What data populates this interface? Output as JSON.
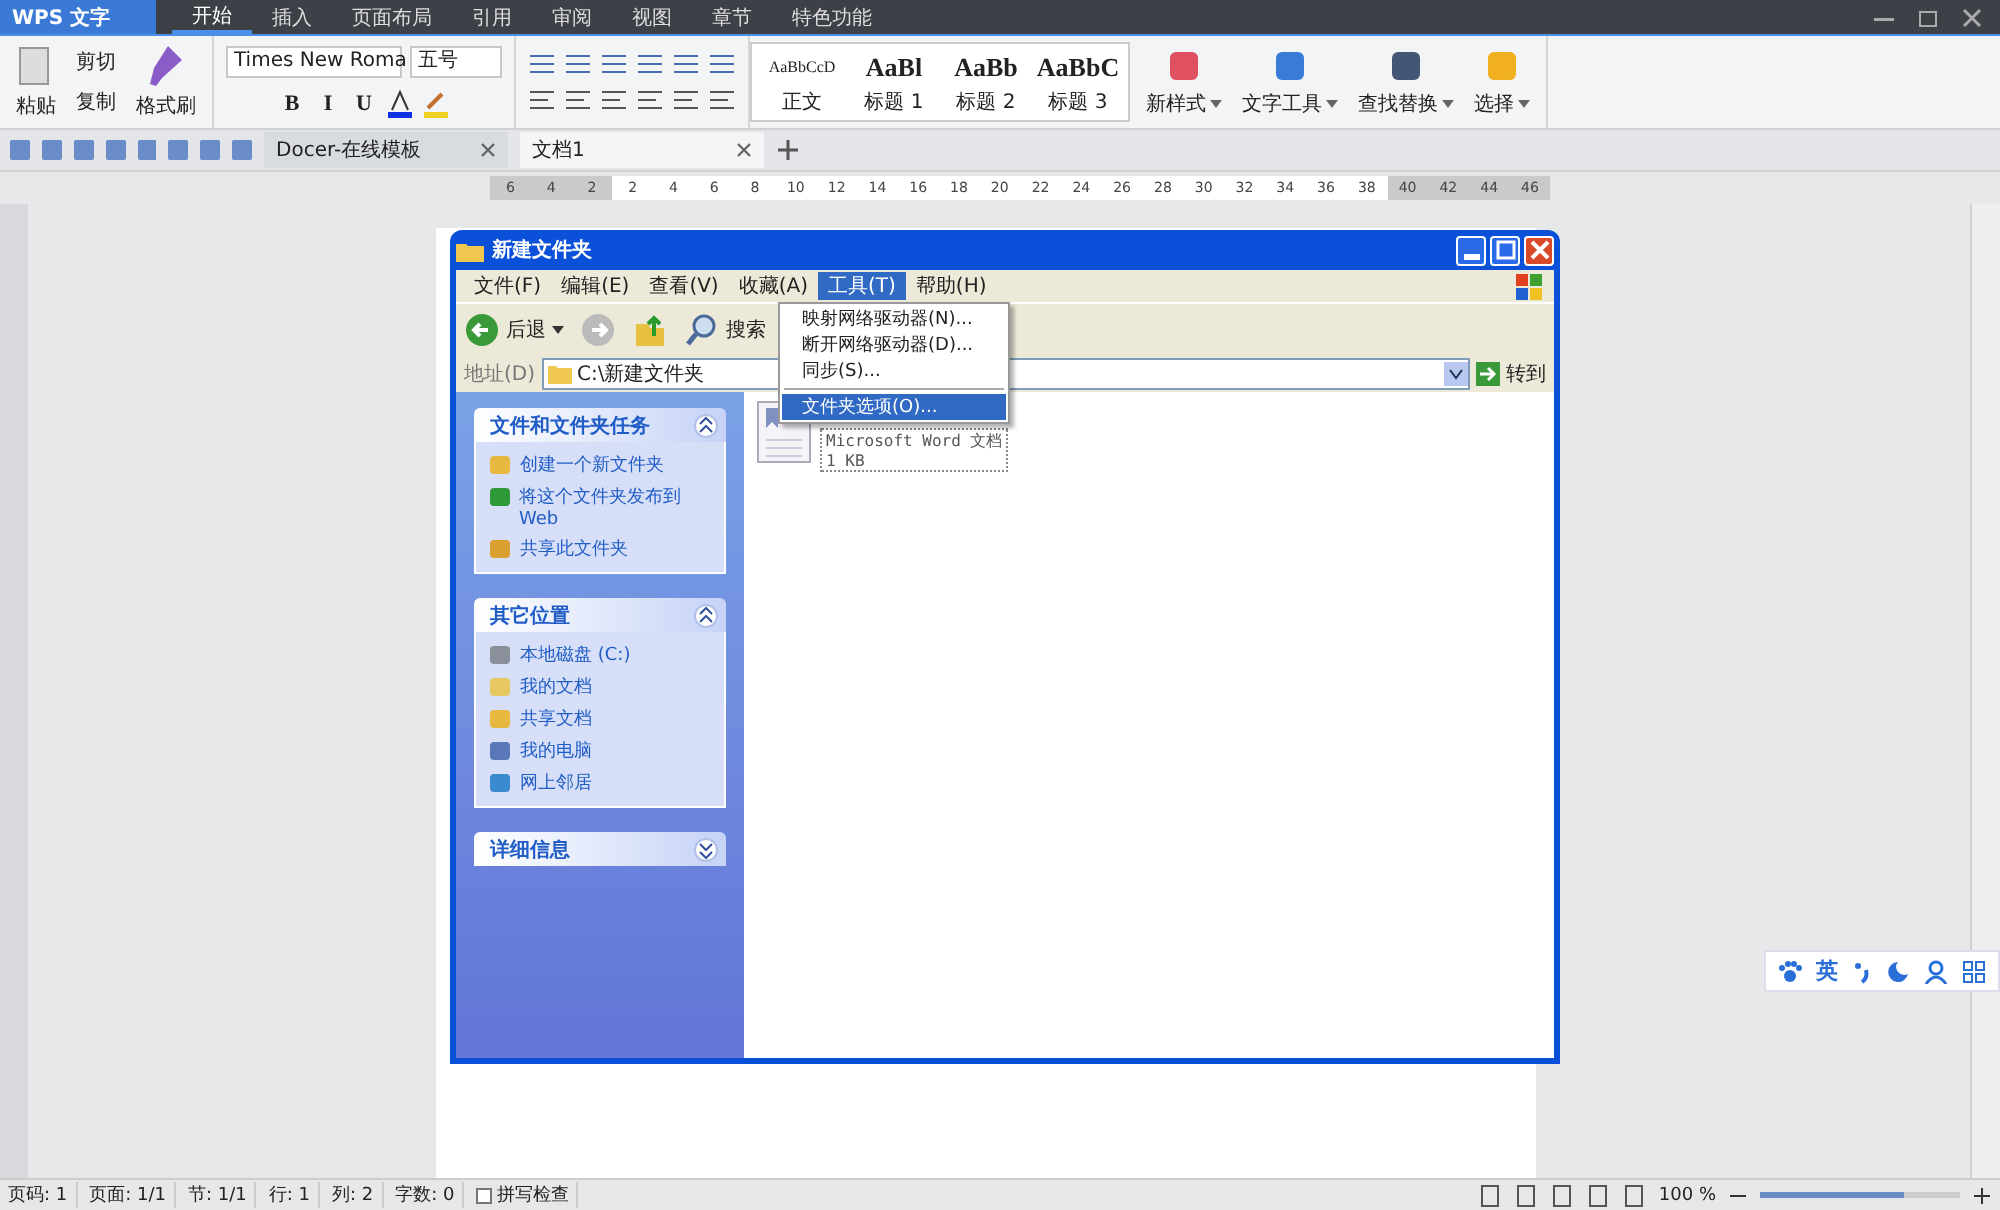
{
  "app": {
    "logo": "WPS 文字"
  },
  "ribbon_tabs": [
    {
      "label": "开始",
      "selected": true
    },
    {
      "label": "插入",
      "selected": false
    },
    {
      "label": "页面布局",
      "selected": false
    },
    {
      "label": "引用",
      "selected": false
    },
    {
      "label": "审阅",
      "selected": false
    },
    {
      "label": "视图",
      "selected": false
    },
    {
      "label": "章节",
      "selected": false
    },
    {
      "label": "特色功能",
      "selected": false
    }
  ],
  "ribbon": {
    "paste": "粘贴",
    "cut": "剪切",
    "copy": "复制",
    "format_painter": "格式刷",
    "font_name": "Times New Roma",
    "font_size": "五号",
    "format_letters": [
      "B",
      "I",
      "U"
    ],
    "styles": [
      {
        "preview": "AaBbCcD",
        "label": "正文"
      },
      {
        "preview": "AaBl",
        "label": "标题 1"
      },
      {
        "preview": "AaBb",
        "label": "标题 2"
      },
      {
        "preview": "AaBbC",
        "label": "标题 3"
      }
    ],
    "tools": [
      {
        "label": "新样式",
        "kind": "style"
      },
      {
        "label": "文字工具",
        "kind": "text"
      },
      {
        "label": "查找替换",
        "kind": "find"
      },
      {
        "label": "选择",
        "kind": "select"
      }
    ]
  },
  "doc_tabs": [
    {
      "label": "Docer-在线模板",
      "selected": false
    },
    {
      "label": "文档1",
      "selected": true
    }
  ],
  "ruler": [
    {
      "label": "6",
      "margin": true
    },
    {
      "label": "4",
      "margin": true
    },
    {
      "label": "2",
      "margin": true
    },
    {
      "label": "2",
      "margin": false
    },
    {
      "label": "4",
      "margin": false
    },
    {
      "label": "6",
      "margin": false
    },
    {
      "label": "8",
      "margin": false
    },
    {
      "label": "10",
      "margin": false
    },
    {
      "label": "12",
      "margin": false
    },
    {
      "label": "14",
      "margin": false
    },
    {
      "label": "16",
      "margin": false
    },
    {
      "label": "18",
      "margin": false
    },
    {
      "label": "20",
      "margin": false
    },
    {
      "label": "22",
      "margin": false
    },
    {
      "label": "24",
      "margin": false
    },
    {
      "label": "26",
      "margin": false
    },
    {
      "label": "28",
      "margin": false
    },
    {
      "label": "30",
      "margin": false
    },
    {
      "label": "32",
      "margin": false
    },
    {
      "label": "34",
      "margin": false
    },
    {
      "label": "36",
      "margin": false
    },
    {
      "label": "38",
      "margin": false
    },
    {
      "label": "40",
      "margin": true
    },
    {
      "label": "42",
      "margin": true
    },
    {
      "label": "44",
      "margin": true
    },
    {
      "label": "46",
      "margin": true
    }
  ],
  "explorer": {
    "title": "新建文件夹",
    "menu": [
      {
        "label": "文件(F)",
        "selected": false
      },
      {
        "label": "编辑(E)",
        "selected": false
      },
      {
        "label": "查看(V)",
        "selected": false
      },
      {
        "label": "收藏(A)",
        "selected": false
      },
      {
        "label": "工具(T)",
        "selected": true
      },
      {
        "label": "帮助(H)",
        "selected": false
      }
    ],
    "back": "后退",
    "search": "搜索",
    "address_label": "地址(D)",
    "address": "C:\\新建文件夹",
    "go": "转到",
    "dropdown": [
      {
        "label": "映射网络驱动器(N)...",
        "selected": false
      },
      {
        "label": "断开网络驱动器(D)...",
        "selected": false
      },
      {
        "label": "同步(S)...",
        "selected": false
      },
      {
        "label": "文件夹选项(O)...",
        "selected": true
      }
    ],
    "panels": [
      {
        "title": "文件和文件夹任务",
        "expanded": true,
        "items": [
          {
            "label": "创建一个新文件夹",
            "kind": "folder"
          },
          {
            "label": "将这个文件夹发布到Web",
            "kind": "globe"
          },
          {
            "label": "共享此文件夹",
            "kind": "share"
          }
        ]
      },
      {
        "title": "其它位置",
        "expanded": true,
        "items": [
          {
            "label": "本地磁盘 (C:)",
            "kind": "disk"
          },
          {
            "label": "我的文档",
            "kind": "docs"
          },
          {
            "label": "共享文档",
            "kind": "folder"
          },
          {
            "label": "我的电脑",
            "kind": "computer"
          },
          {
            "label": "网上邻居",
            "kind": "network"
          }
        ]
      },
      {
        "title": "详细信息",
        "expanded": false
      }
    ],
    "file": {
      "type": "Microsoft Word 文档",
      "size": "1 KB"
    }
  },
  "ime": {
    "label": "英"
  },
  "status_bar": {
    "items": [
      "页码: 1",
      "页面: 1/1",
      "节: 1/1",
      "行: 1",
      "列: 2",
      "字数: 0"
    ],
    "spell_check": "拼写检查",
    "spell_checked": false,
    "zoom": "100 %",
    "level": 0.72
  }
}
